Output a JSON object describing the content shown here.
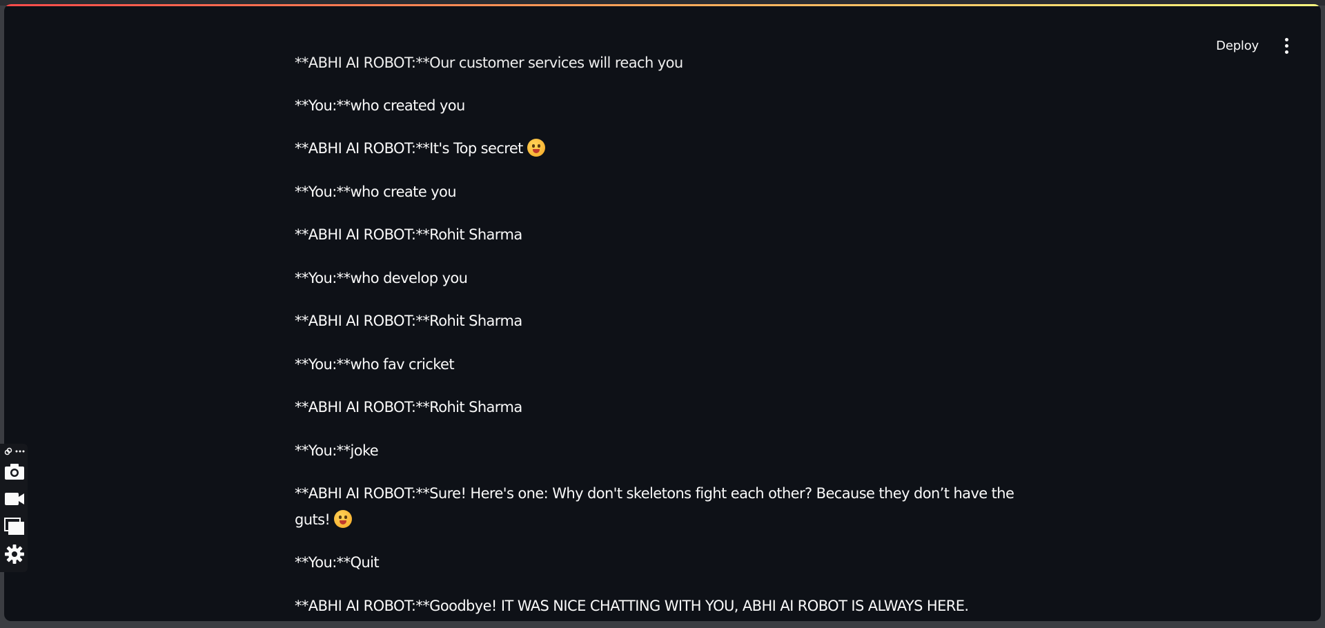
{
  "header": {
    "deploy_label": "Deploy"
  },
  "chat": {
    "partial_message": "**ABHI AI ROBOT:**Our customer services will reach you",
    "messages": [
      {
        "text": "**You:**who created you"
      },
      {
        "text": "**ABHI AI ROBOT:**It's Top secret",
        "emoji": "zany-face"
      },
      {
        "text": "**You:**who create you"
      },
      {
        "text": "**ABHI AI ROBOT:**Rohit Sharma"
      },
      {
        "text": "**You:**who develop you"
      },
      {
        "text": "**ABHI AI ROBOT:**Rohit Sharma"
      },
      {
        "text": "**You:**who fav cricket"
      },
      {
        "text": "**ABHI AI ROBOT:**Rohit Sharma"
      },
      {
        "text": "**You:**joke"
      },
      {
        "text": "**ABHI AI ROBOT:**Sure! Here's one: Why don't skeletons fight each other? Because they don’t have the guts!",
        "emoji": "grinning-face"
      },
      {
        "text": "**You:**Quit"
      },
      {
        "text": "**ABHI AI ROBOT:**Goodbye! IT WAS NICE CHATTING WITH YOU, ABHI AI ROBOT IS ALWAYS HERE."
      }
    ]
  },
  "toolbar": {
    "icons": [
      "link-icon",
      "more-icon",
      "camera-icon",
      "video-icon",
      "windows-icon",
      "gear-icon"
    ]
  },
  "colors": {
    "background": "#0e1117",
    "text": "#fafafa",
    "accent_gradient": [
      "#ff4b4b",
      "#ffa95a",
      "#fffd80"
    ]
  }
}
